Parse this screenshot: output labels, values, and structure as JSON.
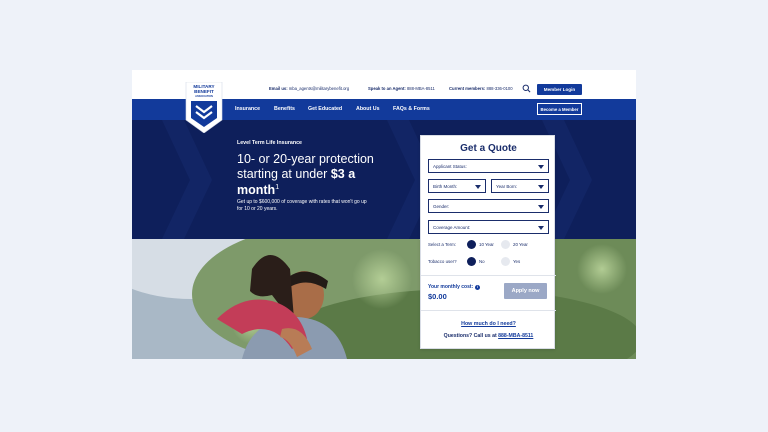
{
  "colors": {
    "navy": "#0e1f5b",
    "brand_blue": "#123a9b",
    "disabled_button": "#9ba8c6",
    "page_bg": "#eef2f9"
  },
  "logo": {
    "line1": "MILITARY",
    "line2": "BENEFIT",
    "line3": "ASSOCIATION",
    "icon": "shield-chevron-logo"
  },
  "topbar": {
    "email_label": "Email us:",
    "email_value": "mba_agents@militarybenefit.org",
    "agent_label": "Speak to an Agent:",
    "agent_value": "888-MBA-8511",
    "members_label": "Current members:",
    "members_value": "888-336-0100",
    "search_icon": "search-icon",
    "login_label": "Member Login"
  },
  "nav": {
    "items": [
      "Insurance",
      "Benefits",
      "Get Educated",
      "About Us",
      "FAQs & Forms"
    ],
    "become_member_label": "Become a Member"
  },
  "hero": {
    "eyebrow": "Level Term Life Insurance",
    "headline_part1": "10- or 20-year protection starting at under ",
    "headline_bold": "$3 a month",
    "headline_sup": "1",
    "subtext": "Get up to $600,000 of coverage with rates that won't go up for 10 or 20 years."
  },
  "quote": {
    "title": "Get a Quote",
    "applicant_status": "Applicant Status:",
    "birth_month": "Birth Month:",
    "year_born": "Year Born:",
    "gender": "Gender:",
    "coverage_amount": "Coverage Amount:",
    "term_label": "Select a Term:",
    "term_options": [
      "10 Year",
      "20 Year"
    ],
    "term_selected": "10 Year",
    "tobacco_label": "Tobacco user?",
    "tobacco_options": [
      "No",
      "Yes"
    ],
    "tobacco_selected": "No",
    "monthly_cost_label": "Your monthly cost:",
    "monthly_cost_value": "$0.00",
    "apply_label": "Apply now",
    "need_link": "How much do I need?",
    "questions_text": "Questions? Call us at ",
    "questions_phone": "888-MBA-8511"
  }
}
